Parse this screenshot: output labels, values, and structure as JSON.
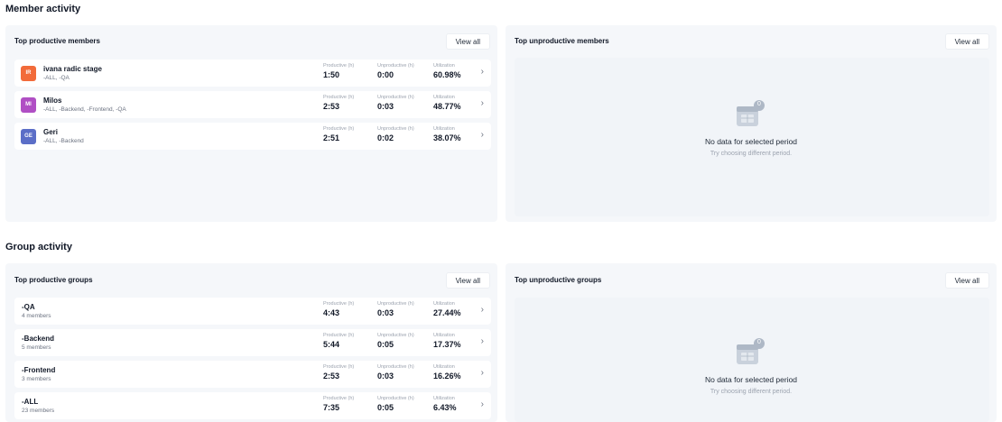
{
  "member_activity": {
    "title": "Member activity",
    "top_productive": {
      "title": "Top productive members",
      "view_all": "View all",
      "stat_labels": {
        "productive": "Productive (h)",
        "unproductive": "Unproductive (h)",
        "utilization": "Utilization"
      },
      "rows": [
        {
          "initials": "IR",
          "color": "#f26b3a",
          "name": "ivana radic stage",
          "groups": "-ALL, -QA",
          "productive": "1:50",
          "unproductive": "0:00",
          "utilization": "60.98%"
        },
        {
          "initials": "MI",
          "color": "#b04fc4",
          "name": "Milos",
          "groups": "-ALL, -Backend, -Frontend, -QA",
          "productive": "2:53",
          "unproductive": "0:03",
          "utilization": "48.77%"
        },
        {
          "initials": "GE",
          "color": "#5b6ec7",
          "name": "Geri",
          "groups": "-ALL, -Backend",
          "productive": "2:51",
          "unproductive": "0:02",
          "utilization": "38.07%"
        }
      ]
    },
    "top_unproductive": {
      "title": "Top unproductive members",
      "view_all": "View all",
      "empty_badge": "0",
      "empty_title": "No data for selected period",
      "empty_sub": "Try choosing different period."
    }
  },
  "group_activity": {
    "title": "Group activity",
    "top_productive": {
      "title": "Top productive groups",
      "view_all": "View all",
      "stat_labels": {
        "productive": "Productive (h)",
        "unproductive": "Unproductive (h)",
        "utilization": "Utilization"
      },
      "rows": [
        {
          "name": "-QA",
          "members": "4 members",
          "productive": "4:43",
          "unproductive": "0:03",
          "utilization": "27.44%"
        },
        {
          "name": "-Backend",
          "members": "5 members",
          "productive": "5:44",
          "unproductive": "0:05",
          "utilization": "17.37%"
        },
        {
          "name": "-Frontend",
          "members": "3 members",
          "productive": "2:53",
          "unproductive": "0:03",
          "utilization": "16.26%"
        },
        {
          "name": "-ALL",
          "members": "23 members",
          "productive": "7:35",
          "unproductive": "0:05",
          "utilization": "6.43%"
        }
      ]
    },
    "top_unproductive": {
      "title": "Top unproductive groups",
      "view_all": "View all",
      "empty_badge": "0",
      "empty_title": "No data for selected period",
      "empty_sub": "Try choosing different period."
    }
  }
}
